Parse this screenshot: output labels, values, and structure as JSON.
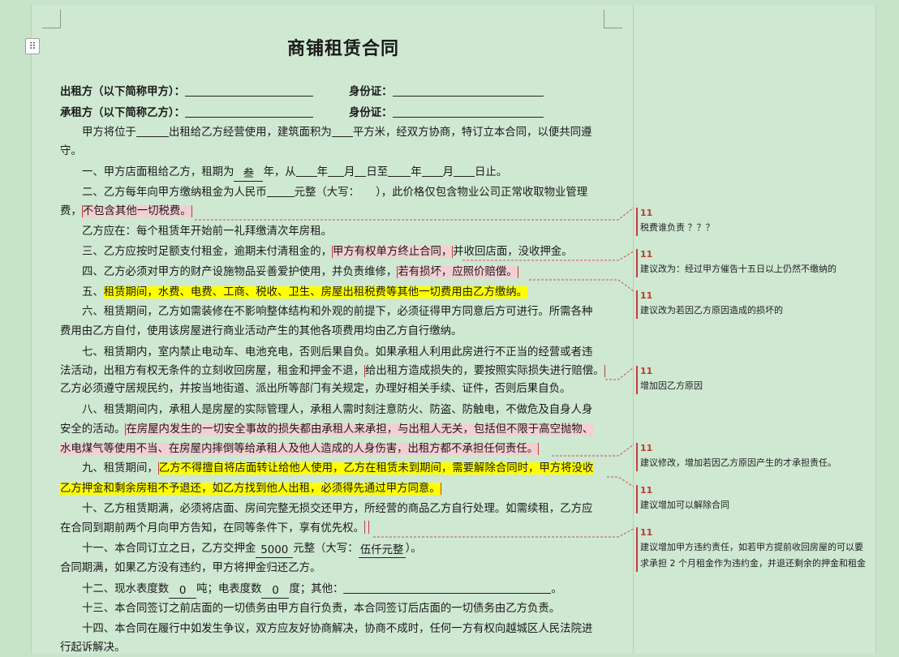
{
  "doc": {
    "title": "商铺租赁合同",
    "party_a_label": "出租方（以下简称甲方）：",
    "party_b_label": "承租方（以下简称乙方）：",
    "id_label": "身份证：",
    "intro_1": "甲方将位于",
    "intro_2": "出租给乙方经营使用，建筑面积为",
    "intro_3": "平方米，经双方协商，特订立本合同，以便共同遵",
    "intro_4": "守。",
    "c1_a": "一、甲方店面租给乙方，租期为",
    "c1_years": "叁",
    "c1_b": "年，从",
    "c1_y1": "年",
    "c1_m1": "月",
    "c1_d1": "日至",
    "c1_y2": "年",
    "c1_m2": "月",
    "c1_d2": "日止。",
    "c2_a": "二、乙方每年向甲方缴纳租金为人民币",
    "c2_b": "元整（大写：　　），此价格仅包含物业公司正常收取物业管理",
    "c2_c": "费，",
    "c2_hl": "不包含其他一切税费。",
    "c3": "乙方应在：每个租赁年开始前一礼拜缴清次年房租。",
    "c4_a": "三、乙方应按时足额支付租金，逾期未付清租金的，",
    "c4_hl": "甲方有权单方终止合同，",
    "c4_b": "并收回店面，没收押金。",
    "c5_a": "四、乙方必须对甲方的财产设施物品妥善爱护使用，并负责维修，",
    "c5_hl": "若有损坏，应照价赔偿。",
    "c6_a": "五、",
    "c6_hl": "租赁期间，水费、电费、工商、税收、卫生、房屋出租税费等其他一切费用由乙方缴纳。",
    "c7_a": "六、租赁期间，乙方如需装修在不影响整体结构和外观的前提下，必须征得甲方同意后方可进行。所需各种",
    "c7_b": "费用由乙方自付，使用该房屋进行商业活动产生的其他各项费用均由乙方自行缴纳。",
    "c8_a": "七、租赁期内，室内禁止电动车、电池充电，否则后果自负。如果承租人利用此房进行不正当的经营或者违",
    "c8_b": "法活动，出租方有权无条件的立刻收回房屋，租金和押金不退，",
    "c8_hl": "给出租方造成损失的，要按照实际损失进行赔偿。",
    "c8_c": "乙方必须遵守居规民约，并按当地街道、派出所等部门有关规定，办理好相关手续、证件，否则后果自负。",
    "c9_a": "八、租赁期间内，承租人是房屋的实际管理人，承租人需时刻注意防火、防盗、防触电，不做危及自身人身",
    "c9_b": "安全的活动。",
    "c9_hl1": "在房屋内发生的一切安全事故的损失都由承租人来承担，与出租人无关，包括但不限于高空抛物、",
    "c9_hl2": "水电煤气等使用不当、在房屋内摔倒等给承租人及他人造成的人身伤害，出租方都不承担任何责任。",
    "c10_a": "九、租赁期间，",
    "c10_hl1": "乙方不得擅自将店面转让给他人使用，乙方在租赁未到期间，需要解除合同时，甲方将没收",
    "c10_hl2": "乙方押金和剩余房租不予退还，如乙方找到他人出租，必须得先通过甲方同意。",
    "c11_a": "十、乙方租赁期满，必须将店面、房间完整无损交还甲方，所经营的商品乙方自行处理。如需续租，乙方应",
    "c11_b": "在合同到期前两个月向甲方告知，在同等条件下，享有优先权。",
    "c12_a": "十一、本合同订立之日，乙方交押金",
    "c12_amount": "5000",
    "c12_b": "元整（大写：",
    "c12_words": "伍仟元整",
    "c12_c": "）。",
    "c12_d": "合同期满，如果乙方没有违约，甲方将押金归还乙方。",
    "c13_a": "十二、现水表度数",
    "c13_water": "0",
    "c13_b": "吨；电表度数",
    "c13_elec": "0",
    "c13_c": "度；其他：",
    "c13_d": "。",
    "c14": "十三、本合同签订之前店面的一切债务由甲方自行负责，本合同签订后店面的一切债务由乙方负责。",
    "c15_a": "十四、本合同在履行中如发生争议，双方应友好协商解决，协商不成时，任何一方有权向越城区人民法院进",
    "c15_b": "行起诉解决。"
  },
  "comments": [
    {
      "author": "11",
      "text": "税费谁负责 ？？？"
    },
    {
      "author": "11",
      "text": "建议改为：经过甲方催告十五日以上仍然不缴纳的"
    },
    {
      "author": "11",
      "text": "建议改为若因乙方原因造成的损坏的"
    },
    {
      "author": "11",
      "text": "增加因乙方原因"
    },
    {
      "author": "11",
      "text": "建议修改，增加若因乙方原因产生的才承担责任。"
    },
    {
      "author": "11",
      "text": "建议增加可以解除合同"
    },
    {
      "author": "11",
      "text": "建议增加甲方违约责任，如若甲方提前收回房屋的可以要求承担 2 个月租金作为违约金，并退还剩余的押金和租金"
    }
  ],
  "colors": {
    "page_bg": "#cfe8d2",
    "highlight_pink": "#f3cfd3",
    "highlight_yellow": "#ffff00",
    "comment_accent": "#c73c3c"
  },
  "icons": {
    "move_handle": "move-handle-icon"
  }
}
